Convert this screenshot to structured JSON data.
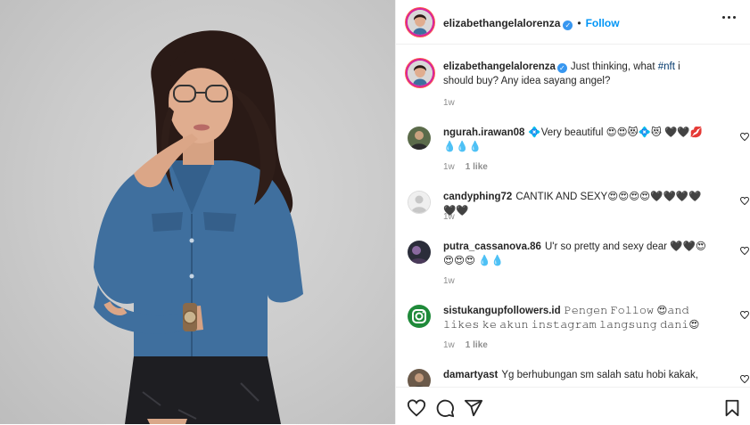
{
  "header": {
    "username": "elizabethangelalorenza",
    "separator": "•",
    "follow_label": "Follow"
  },
  "caption": {
    "username": "elizabethangelalorenza",
    "text_before": "Just thinking, what ",
    "hashtag": "#nft",
    "text_after": " i should buy? Any idea sayang angel?",
    "time": "1w"
  },
  "comments": [
    {
      "username": "ngurah.irawan08",
      "text": "💠Very beautiful 😍😍😻💠😻 🖤🖤💋💧💧💧",
      "time": "1w",
      "likes": "1 like"
    },
    {
      "username": "candyphing72",
      "text": "CANTIK AND SEXY😍😍😍😍🖤🖤🖤🖤🖤🖤",
      "time": "1w",
      "likes": ""
    },
    {
      "username": "putra_cassanova.86",
      "text": "U'r so pretty and sexy dear 🖤🖤😍😍😍😍 💧💧",
      "time": "1w",
      "likes": ""
    },
    {
      "username": "sistukangupfollowers.id",
      "text": "𝙿𝚎𝚗𝚐𝚎𝚗 𝙵𝚘𝚕𝚕𝚘𝚠 😍𝚊𝚗𝚍 𝚕𝚒𝚔𝚎𝚜 𝚔𝚎 𝚊𝚔𝚞𝚗 𝚒𝚗𝚜𝚝𝚊𝚐𝚛𝚊𝚖 𝚕𝚊𝚗𝚐𝚜𝚞𝚗𝚐 𝚍𝚊𝚗𝚒😍",
      "time": "1w",
      "likes": "1 like"
    },
    {
      "username": "damartyast",
      "text": "Yg berhubungan sm salah satu hobi kakak,",
      "time": "",
      "likes": ""
    }
  ],
  "icons": {
    "like": "heart-icon",
    "comment": "comment-icon",
    "share": "paper-plane-icon",
    "save": "bookmark-icon",
    "more": "more-icon",
    "verified": "verified-badge-icon"
  },
  "colors": {
    "accent": "#0095f6",
    "verified": "#3897f0",
    "shirt": "#3f6f9e"
  }
}
